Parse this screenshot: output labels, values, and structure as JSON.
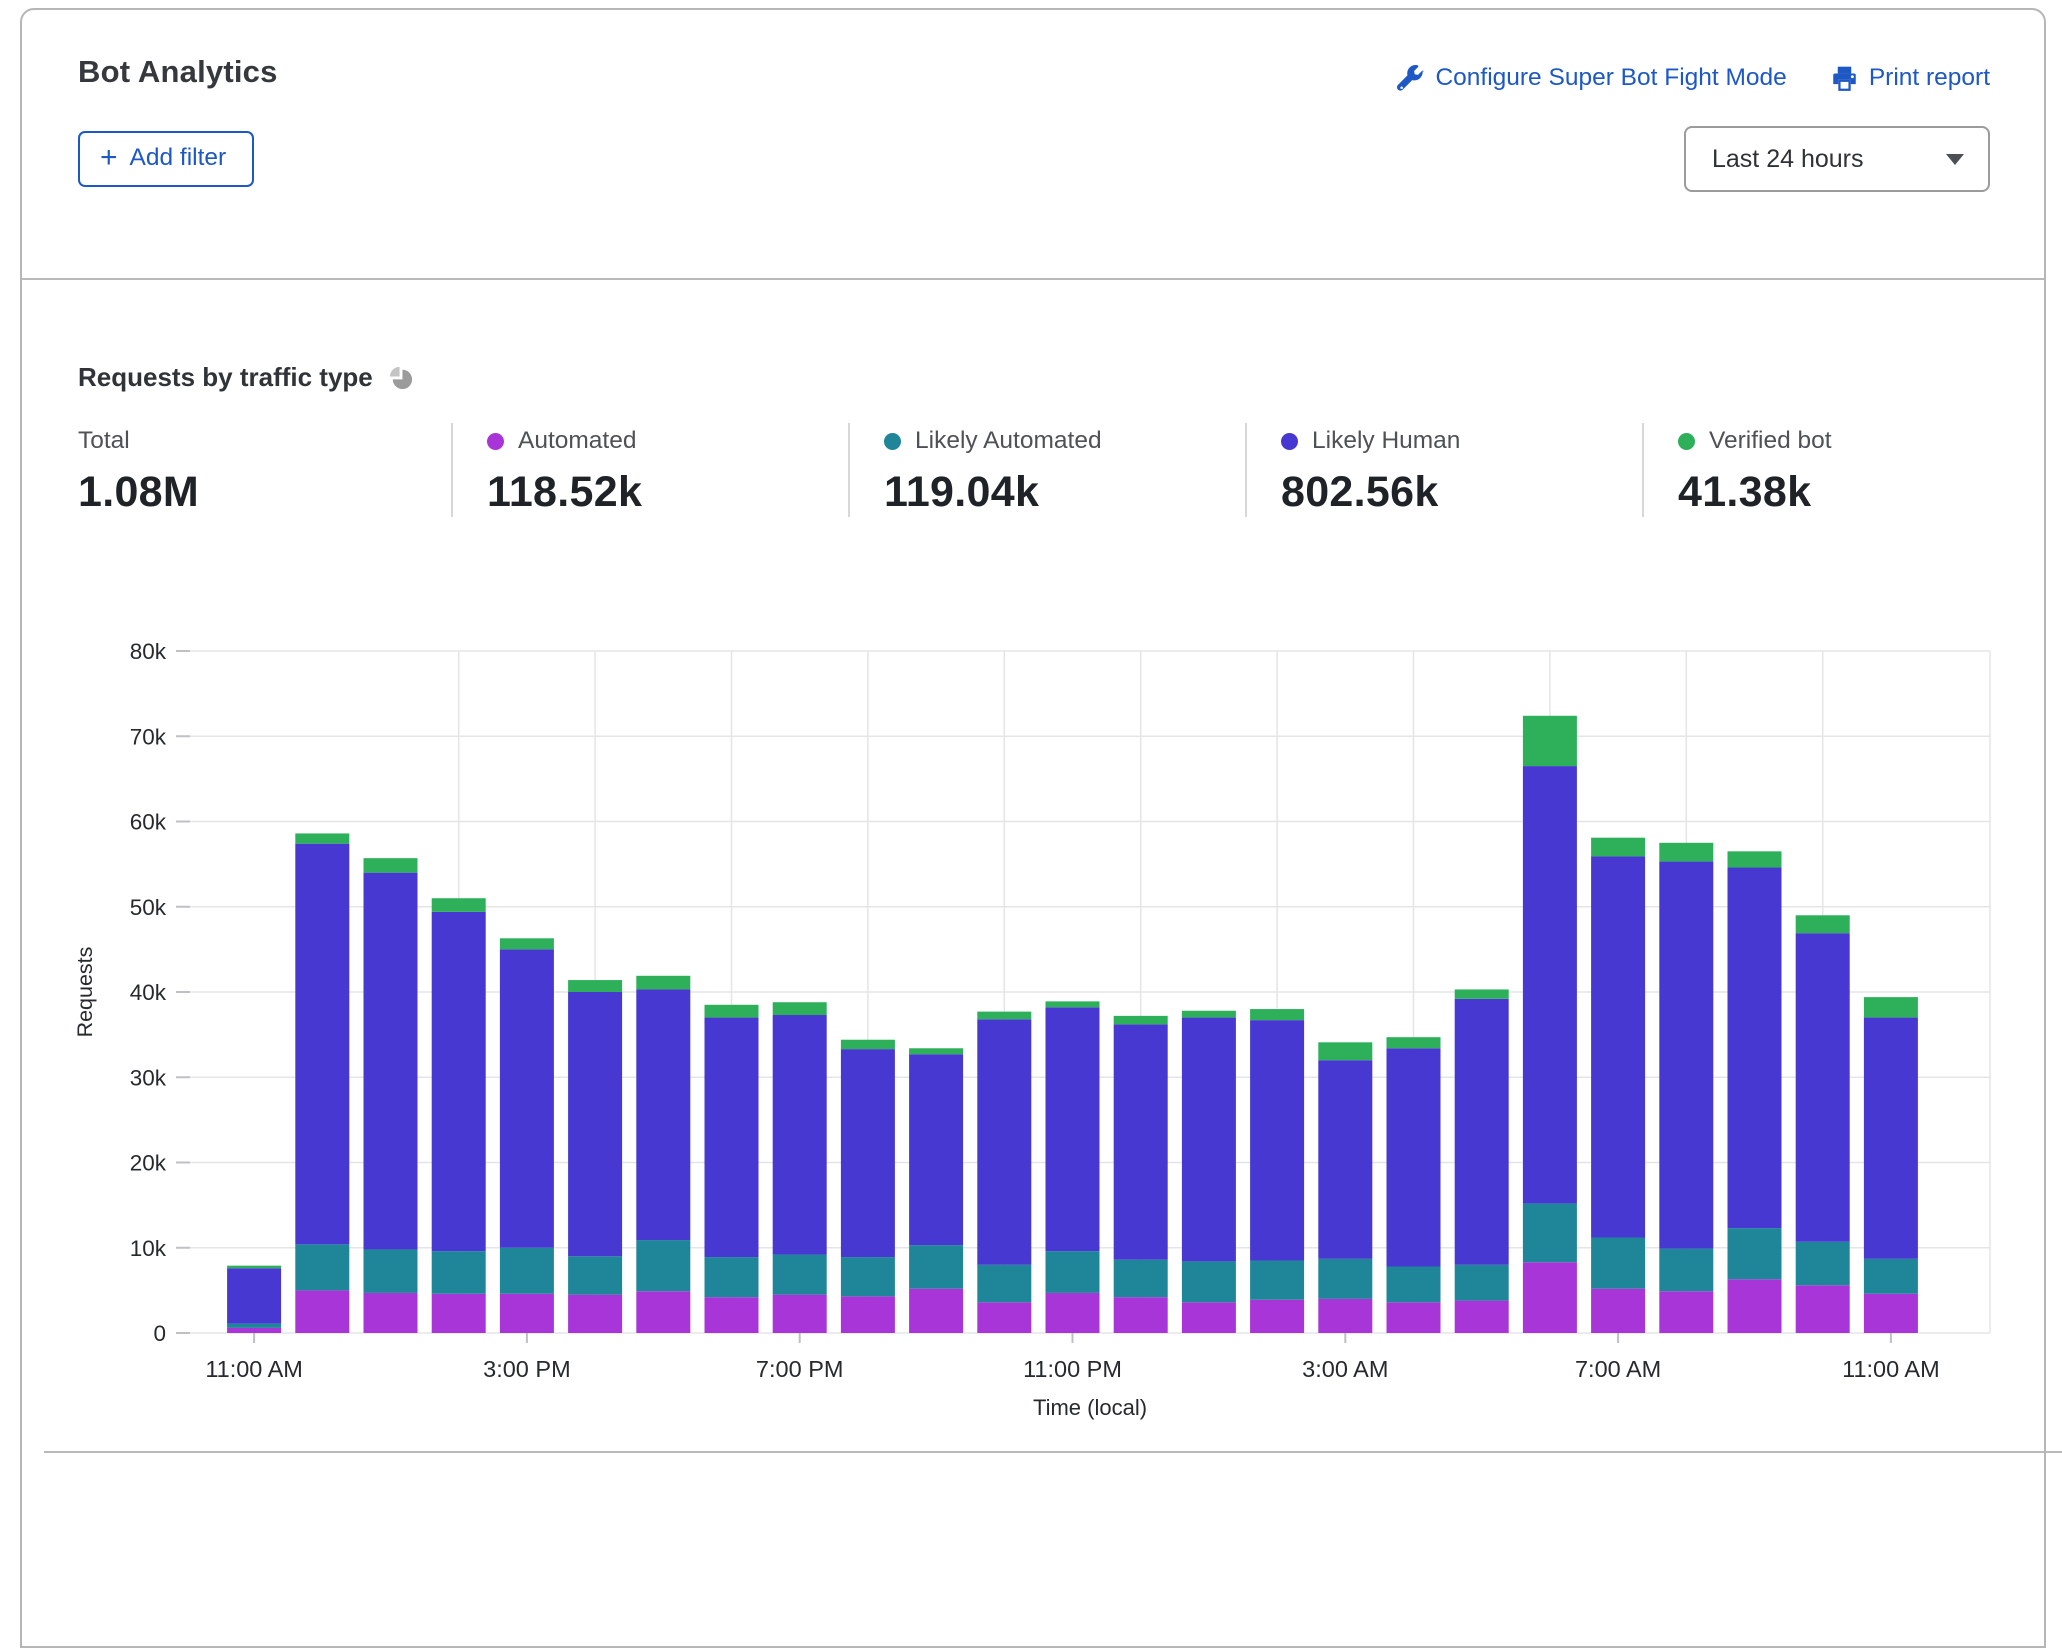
{
  "header": {
    "title": "Bot Analytics",
    "configure_link": "Configure Super Bot Fight Mode",
    "print_link": "Print report",
    "add_filter_label": "Add filter",
    "plus": "+",
    "time_range_selected": "Last 24 hours"
  },
  "section": {
    "title": "Requests by traffic type"
  },
  "stats": [
    {
      "label": "Total",
      "value": "1.08M",
      "color": null
    },
    {
      "label": "Automated",
      "value": "118.52k",
      "color": "#a835d8"
    },
    {
      "label": "Likely Automated",
      "value": "119.04k",
      "color": "#1f869a"
    },
    {
      "label": "Likely Human",
      "value": "802.56k",
      "color": "#4638d1"
    },
    {
      "label": "Verified bot",
      "value": "41.38k",
      "color": "#2eb05b"
    }
  ],
  "chart_data": {
    "type": "bar",
    "stacked": true,
    "title": "Requests by traffic type",
    "xlabel": "Time (local)",
    "ylabel": "Requests",
    "values_unit": "thousands of requests",
    "y_max": 80,
    "y_step": 10,
    "grid": true,
    "y_tick_labels": [
      "0",
      "10k",
      "20k",
      "30k",
      "40k",
      "50k",
      "60k",
      "70k",
      "80k"
    ],
    "tick_every": 4,
    "categories": [
      "11:00 AM",
      "12:00 PM",
      "1:00 PM",
      "2:00 PM",
      "3:00 PM",
      "4:00 PM",
      "5:00 PM",
      "6:00 PM",
      "7:00 PM",
      "8:00 PM",
      "9:00 PM",
      "10:00 PM",
      "11:00 PM",
      "12:00 AM",
      "1:00 AM",
      "2:00 AM",
      "3:00 AM",
      "4:00 AM",
      "5:00 AM",
      "6:00 AM",
      "7:00 AM",
      "8:00 AM",
      "9:00 AM",
      "10:00 AM",
      "11:00 AM"
    ],
    "series": [
      {
        "name": "Automated",
        "color": "#a835d8",
        "values": [
          0.6,
          5.0,
          4.7,
          4.6,
          4.6,
          4.5,
          4.9,
          4.2,
          4.5,
          4.3,
          5.2,
          3.6,
          4.7,
          4.2,
          3.6,
          3.9,
          4.0,
          3.6,
          3.8,
          8.3,
          5.2,
          4.9,
          6.3,
          5.6,
          4.6
        ]
      },
      {
        "name": "Likely Automated",
        "color": "#1f869a",
        "values": [
          0.5,
          5.4,
          5.1,
          5.0,
          5.4,
          4.5,
          6.0,
          4.7,
          4.7,
          4.6,
          5.1,
          4.4,
          4.9,
          4.4,
          4.8,
          4.6,
          4.7,
          4.2,
          4.2,
          6.9,
          6.0,
          5.0,
          6.0,
          5.1,
          4.1
        ]
      },
      {
        "name": "Likely Human",
        "color": "#4638d1",
        "values": [
          6.5,
          47.0,
          44.2,
          39.8,
          35.0,
          31.0,
          29.4,
          28.1,
          28.1,
          24.4,
          22.4,
          28.8,
          28.6,
          27.6,
          28.6,
          28.2,
          23.3,
          25.6,
          31.2,
          51.3,
          44.7,
          45.4,
          42.3,
          36.2,
          28.3
        ]
      },
      {
        "name": "Verified bot",
        "color": "#2eb05b",
        "values": [
          0.3,
          1.2,
          1.7,
          1.6,
          1.3,
          1.4,
          1.6,
          1.5,
          1.5,
          1.1,
          0.7,
          0.9,
          0.7,
          1.0,
          0.8,
          1.3,
          2.1,
          1.3,
          1.1,
          5.9,
          2.2,
          2.2,
          1.9,
          2.1,
          2.4
        ]
      }
    ]
  },
  "colors": {
    "link_blue": "#1d58c5",
    "card_border": "#b6b6b6",
    "divider": "#b9b9b9",
    "gridline": "#e5e5e8"
  }
}
